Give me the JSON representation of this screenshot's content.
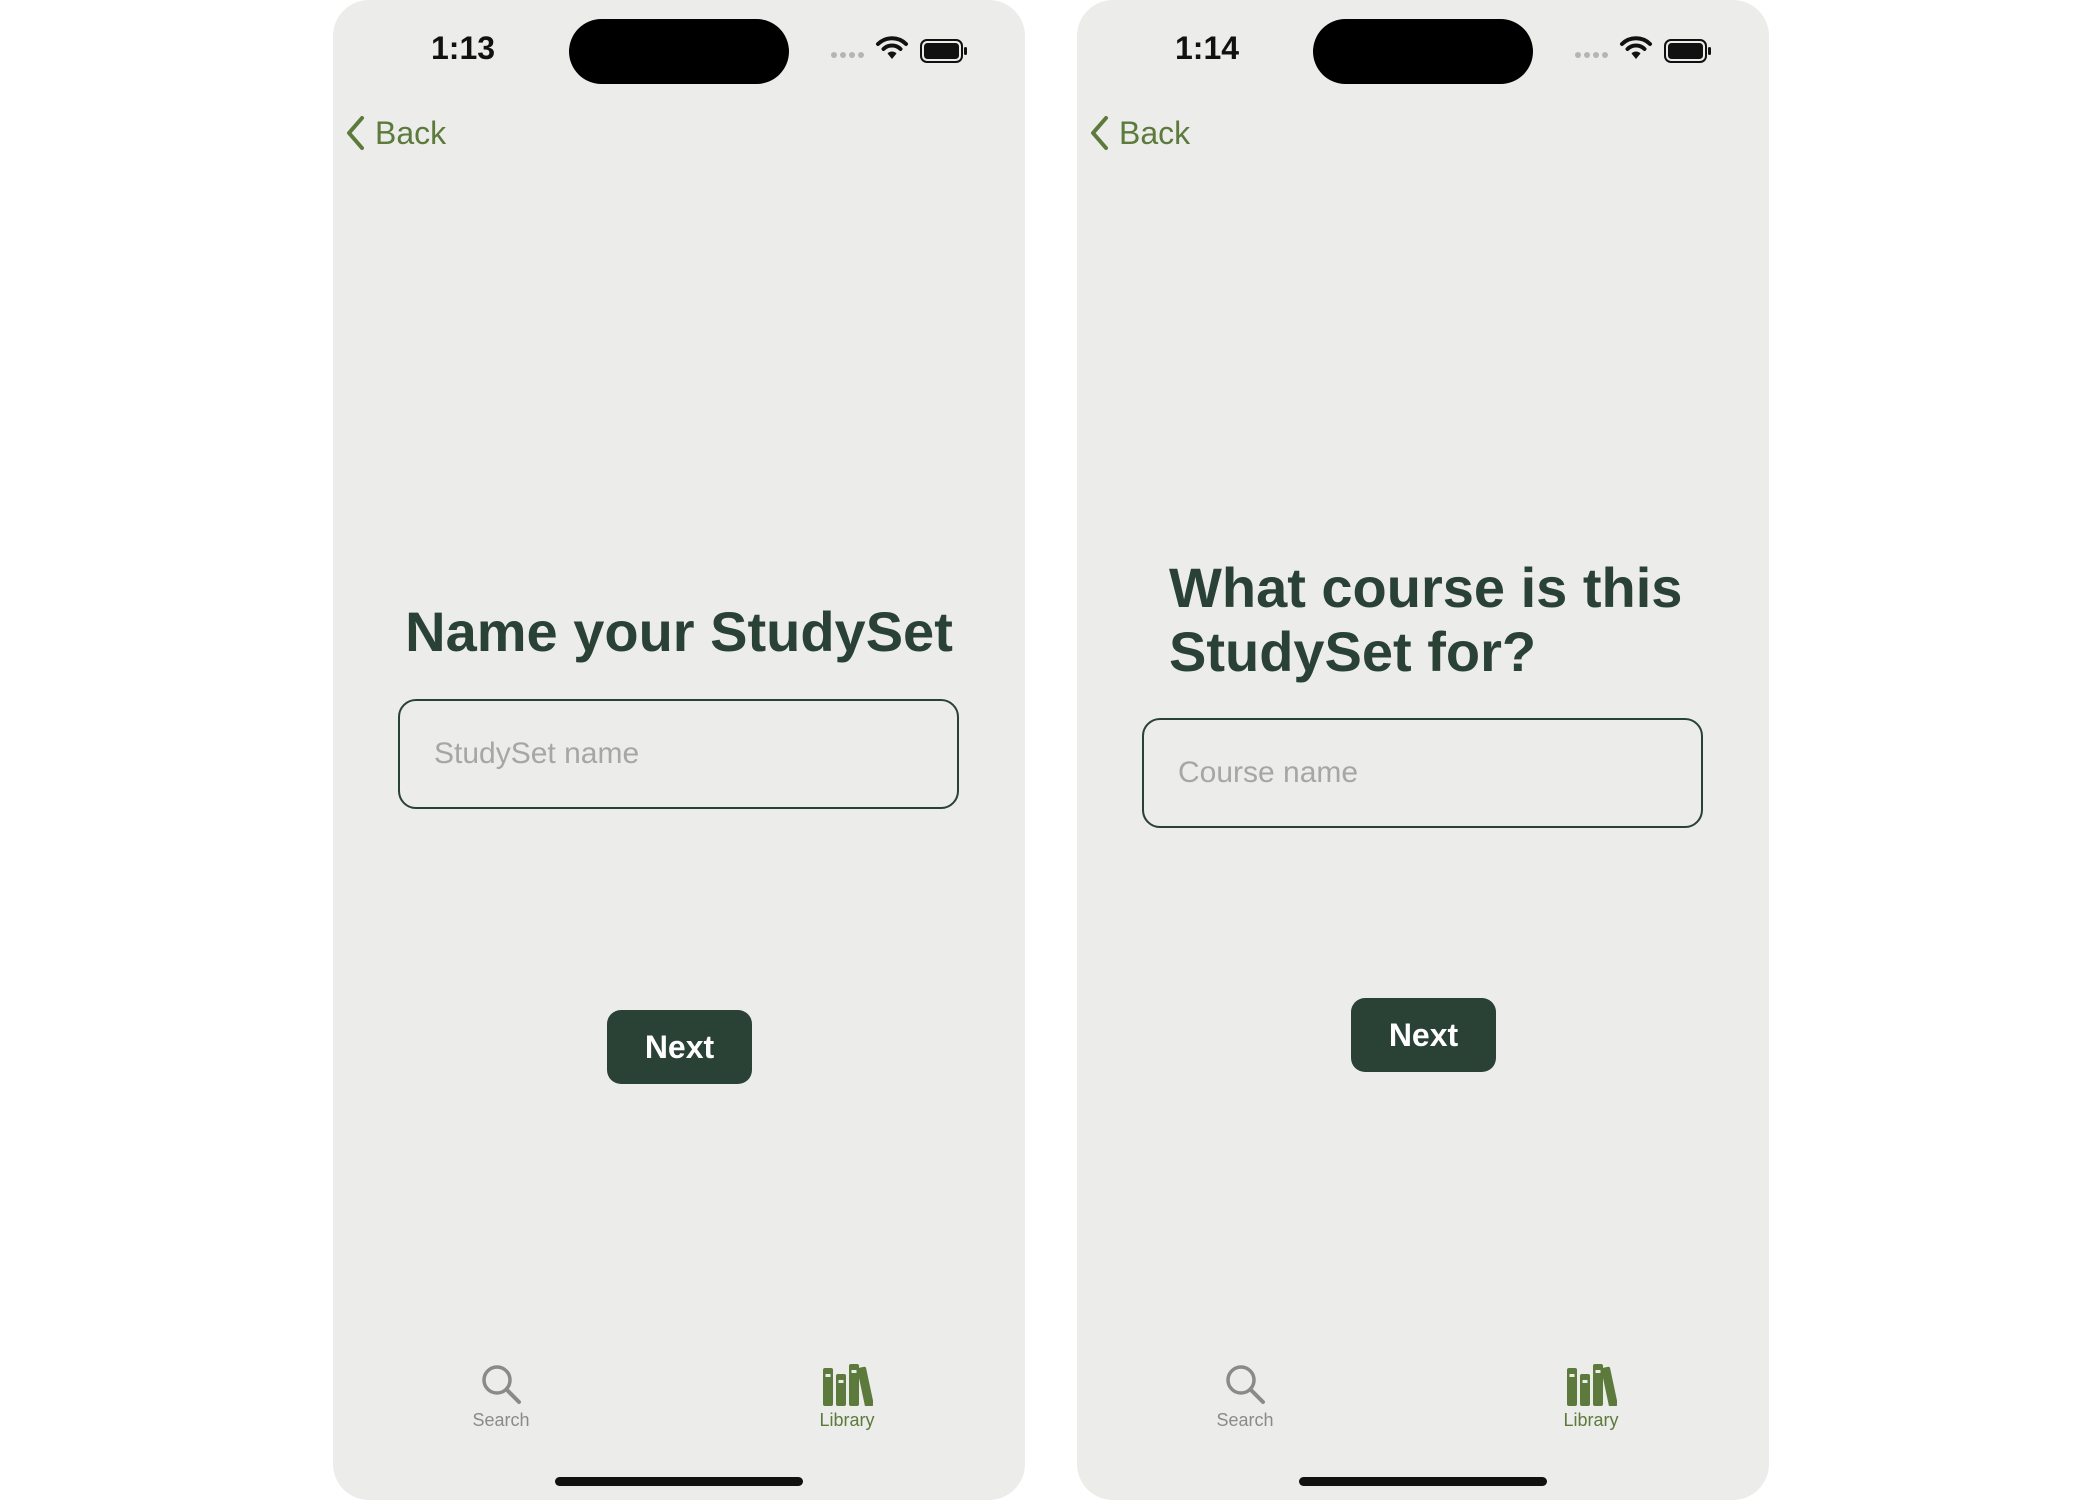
{
  "screens": [
    {
      "status_time": "1:13",
      "back_label": "Back",
      "title": "Name your StudySet",
      "input": {
        "value": "",
        "placeholder": "StudySet name"
      },
      "next_label": "Next",
      "tabs": [
        {
          "label": "Search",
          "icon": "search-icon",
          "active": false
        },
        {
          "label": "Library",
          "icon": "books-icon",
          "active": true
        }
      ]
    },
    {
      "status_time": "1:14",
      "back_label": "Back",
      "title": "What course is this StudySet for?",
      "input": {
        "value": "",
        "placeholder": "Course name"
      },
      "next_label": "Next",
      "tabs": [
        {
          "label": "Search",
          "icon": "search-icon",
          "active": false
        },
        {
          "label": "Library",
          "icon": "books-icon",
          "active": true
        }
      ]
    }
  ],
  "colors": {
    "accent": "#5b7a3b",
    "primary_dark": "#2a4236",
    "background": "#ececea",
    "inactive": "#8a8a8a"
  }
}
